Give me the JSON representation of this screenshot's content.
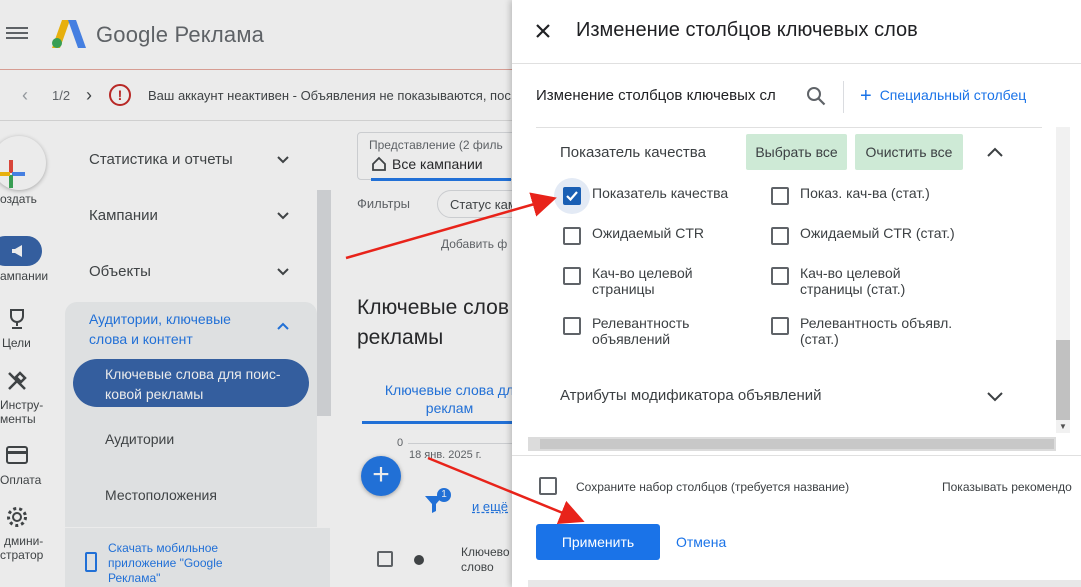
{
  "app": {
    "brand": "Google Реклама",
    "pager": "1/2",
    "notice": "Ваш аккаунт неактивен - Объявления не показываются, пос"
  },
  "rail": {
    "create": "оздать",
    "campaigns": "ампании",
    "goals": "Цели",
    "tools_line1": "Инстру-",
    "tools_line2": "менты",
    "billing": "Оплата",
    "admin_line1": "дмини-",
    "admin_line2": "стратор"
  },
  "nav": {
    "items": [
      {
        "label": "Статистика и отчеты"
      },
      {
        "label": "Кампании"
      },
      {
        "label": "Объекты"
      }
    ],
    "group_title_line1": "Аудитории, ключевые",
    "group_title_line2": "слова и контент",
    "active_line1": "Ключевые слова для поис-",
    "active_line2": "ковой рекламы",
    "sub_items": [
      {
        "label": "Аудитории"
      },
      {
        "label": "Местоположения"
      }
    ],
    "mobile_link": "Скачать мобильное приложение \"Google Реклама\""
  },
  "content": {
    "view_label": "Представление (2 филь",
    "view_value": "Все кампании",
    "filters_label": "Фильтры",
    "status_chip": "Статус кам",
    "add_filter": "Добавить ф",
    "heading_line1": "Ключевые слов",
    "heading_line2": "рекламы",
    "tab_line1": "Ключевые слова дл",
    "tab_line2": "реклам",
    "chart_zero": "0",
    "chart_date": "18 янв. 2025 г.",
    "filter_badge": "1",
    "more_link": "и ещё",
    "row_kw_line1": "Ключево",
    "row_kw_line2": "слово"
  },
  "panel": {
    "title": "Изменение столбцов ключевых слов",
    "search_value": "Изменение столбцов ключевых сл",
    "custom_column": "Специальный столбец",
    "section_title": "Показатель качества",
    "select_all": "Выбрать все",
    "clear_all": "Очистить все",
    "checkboxes": [
      {
        "line1": "Показатель качества",
        "line2": "",
        "checked": true
      },
      {
        "line1": "Показ. кач-ва (стат.)",
        "line2": "",
        "checked": false
      },
      {
        "line1": "Ожидаемый CTR",
        "line2": "",
        "checked": false
      },
      {
        "line1": "Ожидаемый CTR (стат.)",
        "line2": "",
        "checked": false
      },
      {
        "line1": "Кач-во целевой",
        "line2": "страницы",
        "checked": false
      },
      {
        "line1": "Кач-во целевой",
        "line2": "страницы (стат.)",
        "checked": false
      },
      {
        "line1": "Релевантность",
        "line2": "объявлений",
        "checked": false
      },
      {
        "line1": "Релевантность объявл.",
        "line2": "(стат.)",
        "checked": false
      }
    ],
    "attr_section": "Атрибуты модификатора объявлений",
    "save_set": "Сохраните набор столбцов (требуется название)",
    "show_recommend": "Показывать рекомендо",
    "apply": "Применить",
    "cancel": "Отмена"
  },
  "colors": {
    "accent": "#1a73e8",
    "active_nav": "#2f5fa8",
    "select_buttons": "#ceead6",
    "annotation": "#e8231a",
    "warning": "#c5221f"
  }
}
